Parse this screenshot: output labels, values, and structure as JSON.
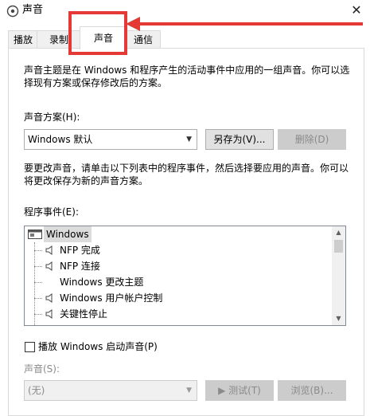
{
  "window": {
    "title": "声音",
    "close_icon": "close-icon"
  },
  "tabs": [
    {
      "label": "播放",
      "active": false
    },
    {
      "label": "录制",
      "active": false
    },
    {
      "label": "声音",
      "active": true
    },
    {
      "label": "通信",
      "active": false
    }
  ],
  "sounds": {
    "description": "声音主题是在 Windows 和程序产生的活动事件中应用的一组声音。你可以选择现有方案或保存修改后的方案。",
    "scheme_label": "声音方案(H):",
    "scheme_value": "Windows 默认",
    "save_as_button": "另存为(V)...",
    "delete_button": "删除(D)",
    "change_description": "要更改声音，请单击以下列表中的程序事件，然后选择要应用的声音。你可以将更改保存为新的声音方案。",
    "events_label": "程序事件(E):",
    "events": [
      {
        "label": "Windows",
        "type": "group",
        "icon": "window-icon"
      },
      {
        "label": "NFP 完成",
        "type": "sound",
        "icon": "speaker-icon"
      },
      {
        "label": "NFP 连接",
        "type": "sound",
        "icon": "speaker-icon"
      },
      {
        "label": "Windows 更改主题",
        "type": "none",
        "icon": ""
      },
      {
        "label": "Windows 用户帐户控制",
        "type": "sound",
        "icon": "speaker-icon"
      },
      {
        "label": "关键性停止",
        "type": "sound",
        "icon": "speaker-icon"
      }
    ],
    "startup_checkbox": "播放 Windows 启动声音(P)",
    "startup_checked": false,
    "sound_label": "声音(S):",
    "sound_value": "(无)",
    "test_button": "▶ 测试(T)",
    "browse_button": "浏览(B)..."
  },
  "colors": {
    "annotation": "#e53935",
    "selection": "#dcdcdc"
  }
}
